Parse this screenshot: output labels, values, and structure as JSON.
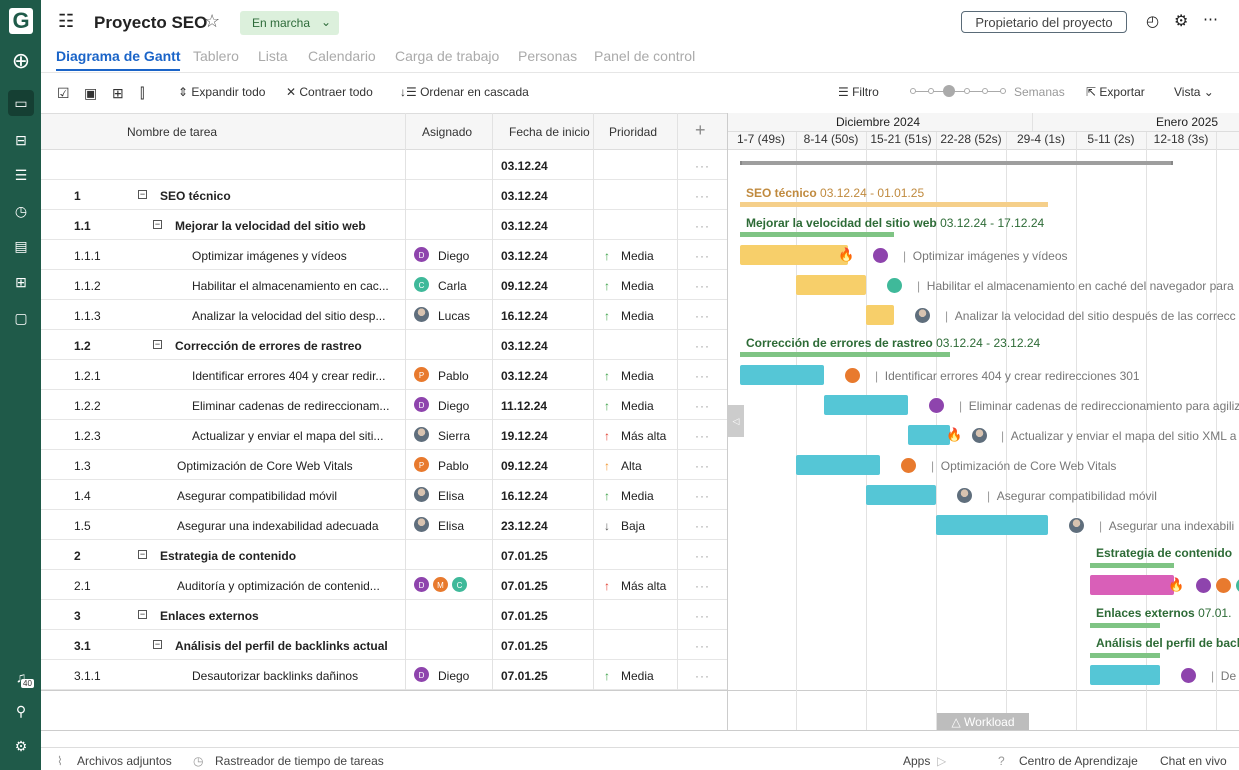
{
  "app": {
    "logo": "G",
    "notifications": "40"
  },
  "header": {
    "title": "Proyecto SEO",
    "status": "En marcha",
    "owner_button": "Propietario del proyecto"
  },
  "tabs": [
    "Diagrama de Gantt",
    "Tablero",
    "Lista",
    "Calendario",
    "Carga de trabajo",
    "Personas",
    "Panel de control"
  ],
  "toolbar": {
    "expand": "Expandir todo",
    "collapse": "Contraer todo",
    "cascade": "Ordenar en cascada",
    "filter": "Filtro",
    "zoom_label": "Semanas",
    "zoom_level": 3,
    "zoom_steps": 6,
    "export": "Exportar",
    "view": "Vista"
  },
  "columns": {
    "name": "Nombre de tarea",
    "assignee": "Asignado",
    "start": "Fecha de inicio",
    "priority": "Prioridad"
  },
  "project_row": {
    "start": "03.12.24"
  },
  "rows": [
    {
      "num": "1",
      "name": "SEO técnico",
      "level": 1,
      "parent": true,
      "start": "03.12.24"
    },
    {
      "num": "1.1",
      "name": "Mejorar la velocidad del sitio web",
      "level": 2,
      "parent": true,
      "start": "03.12.24"
    },
    {
      "num": "1.1.1",
      "name": "Optimizar imágenes y vídeos",
      "level": 3,
      "assignees": [
        {
          "l": "D",
          "c": "#8e44ad"
        }
      ],
      "assignee": "Diego",
      "start": "03.12.24",
      "priority": "Media",
      "pcolor": "#3aa046",
      "arrow": "↑"
    },
    {
      "num": "1.1.2",
      "name": "Habilitar el almacenamiento en cac...",
      "level": 3,
      "assignees": [
        {
          "l": "C",
          "c": "#3fb99a"
        }
      ],
      "assignee": "Carla",
      "start": "09.12.24",
      "priority": "Media",
      "pcolor": "#3aa046",
      "arrow": "↑"
    },
    {
      "num": "1.1.3",
      "name": "Analizar la velocidad del sitio desp...",
      "level": 3,
      "assignees": [
        {
          "photo": true
        }
      ],
      "assignee": "Lucas",
      "start": "16.12.24",
      "priority": "Media",
      "pcolor": "#3aa046",
      "arrow": "↑"
    },
    {
      "num": "1.2",
      "name": "Corrección de errores de rastreo",
      "level": 2,
      "parent": true,
      "start": "03.12.24"
    },
    {
      "num": "1.2.1",
      "name": "Identificar errores 404 y crear redir...",
      "level": 3,
      "assignees": [
        {
          "l": "P",
          "c": "#e87a2e"
        }
      ],
      "assignee": "Pablo",
      "start": "03.12.24",
      "priority": "Media",
      "pcolor": "#3aa046",
      "arrow": "↑"
    },
    {
      "num": "1.2.2",
      "name": "Eliminar cadenas de redireccionam...",
      "level": 3,
      "assignees": [
        {
          "l": "D",
          "c": "#8e44ad"
        }
      ],
      "assignee": "Diego",
      "start": "11.12.24",
      "priority": "Media",
      "pcolor": "#3aa046",
      "arrow": "↑"
    },
    {
      "num": "1.2.3",
      "name": "Actualizar y enviar el mapa del siti...",
      "level": 3,
      "assignees": [
        {
          "photo": true
        }
      ],
      "assignee": "Sierra",
      "start": "19.12.24",
      "priority": "Más alta",
      "pcolor": "#e0392b",
      "arrow": "↑"
    },
    {
      "num": "1.3",
      "name": "Optimización de Core Web Vitals",
      "level": 2,
      "assignees": [
        {
          "l": "P",
          "c": "#e87a2e"
        }
      ],
      "assignee": "Pablo",
      "start": "09.12.24",
      "priority": "Alta",
      "pcolor": "#f0932b",
      "arrow": "↑"
    },
    {
      "num": "1.4",
      "name": "Asegurar compatibilidad móvil",
      "level": 2,
      "assignees": [
        {
          "photo": true
        }
      ],
      "assignee": "Elisa",
      "start": "16.12.24",
      "priority": "Media",
      "pcolor": "#3aa046",
      "arrow": "↑"
    },
    {
      "num": "1.5",
      "name": "Asegurar una indexabilidad adecuada",
      "level": 2,
      "assignees": [
        {
          "photo": true
        }
      ],
      "assignee": "Elisa",
      "start": "23.12.24",
      "priority": "Baja",
      "pcolor": "#555555",
      "arrow": "↓"
    },
    {
      "num": "2",
      "name": "Estrategia de contenido",
      "level": 1,
      "parent": true,
      "start": "07.01.25"
    },
    {
      "num": "2.1",
      "name": "Auditoría y optimización de contenid...",
      "level": 2,
      "assignees": [
        {
          "l": "D",
          "c": "#8e44ad"
        },
        {
          "l": "M",
          "c": "#e87a2e"
        },
        {
          "l": "C",
          "c": "#3fb99a"
        }
      ],
      "start": "07.01.25",
      "priority": "Más alta",
      "pcolor": "#e0392b",
      "arrow": "↑"
    },
    {
      "num": "3",
      "name": "Enlaces externos",
      "level": 1,
      "parent": true,
      "start": "07.01.25"
    },
    {
      "num": "3.1",
      "name": "Análisis del perfil de backlinks actual",
      "level": 2,
      "parent": true,
      "start": "07.01.25"
    },
    {
      "num": "3.1.1",
      "name": "Desautorizar backlinks dañinos",
      "level": 3,
      "assignees": [
        {
          "l": "D",
          "c": "#8e44ad"
        }
      ],
      "assignee": "Diego",
      "start": "07.01.25",
      "priority": "Media",
      "pcolor": "#3aa046",
      "arrow": "↑"
    }
  ],
  "timeline": {
    "months": [
      "Diciembre 2024",
      "Enero 2025"
    ],
    "weeks": [
      "1-7 (49s)",
      "8-14 (50s)",
      "15-21 (51s)",
      "22-28 (52s)",
      "29-4 (1s)",
      "5-11 (2s)",
      "12-18 (3s)",
      "19"
    ]
  },
  "gantt": {
    "seo_label": "SEO técnico",
    "seo_dates": "03.12.24 - 01.01.25",
    "speed_label": "Mejorar la velocidad del sitio web",
    "speed_dates": "03.12.24 - 17.12.24",
    "crawl_label": "Corrección de errores de rastreo",
    "crawl_dates": "03.12.24 - 23.12.24",
    "content_label": "Estrategia de contenido",
    "links_label": "Enlaces externos",
    "links_dates": "07.01.",
    "backlinks_label": "Análisis del perfil de back",
    "t111": "Optimizar imágenes y vídeos",
    "t112": "Habilitar el almacenamiento en caché del navegador para",
    "t113": "Analizar la velocidad del sitio después de las correcc",
    "t121": "Identificar errores 404 y crear redirecciones 301",
    "t122": "Eliminar cadenas de redireccionamiento para agiliz",
    "t123": "Actualizar y enviar el mapa del sitio XML a",
    "t13": "Optimización de Core Web Vitals",
    "t14": "Asegurar compatibilidad móvil",
    "t15": "Asegurar una indexabili",
    "t311": "De",
    "colors": {
      "summary": "#9e9e9e",
      "seo": "#f5cf8a",
      "group": "#7fc484",
      "yellow": "#f7cf6a",
      "cyan": "#55c6d6",
      "magenta": "#d95fb8"
    }
  },
  "workload": "Workload",
  "footer": {
    "attachments": "Archivos adjuntos",
    "tracker": "Rastreador de tiempo de tareas",
    "apps": "Apps",
    "learning": "Centro de Aprendizaje",
    "chat": "Chat en vivo"
  }
}
